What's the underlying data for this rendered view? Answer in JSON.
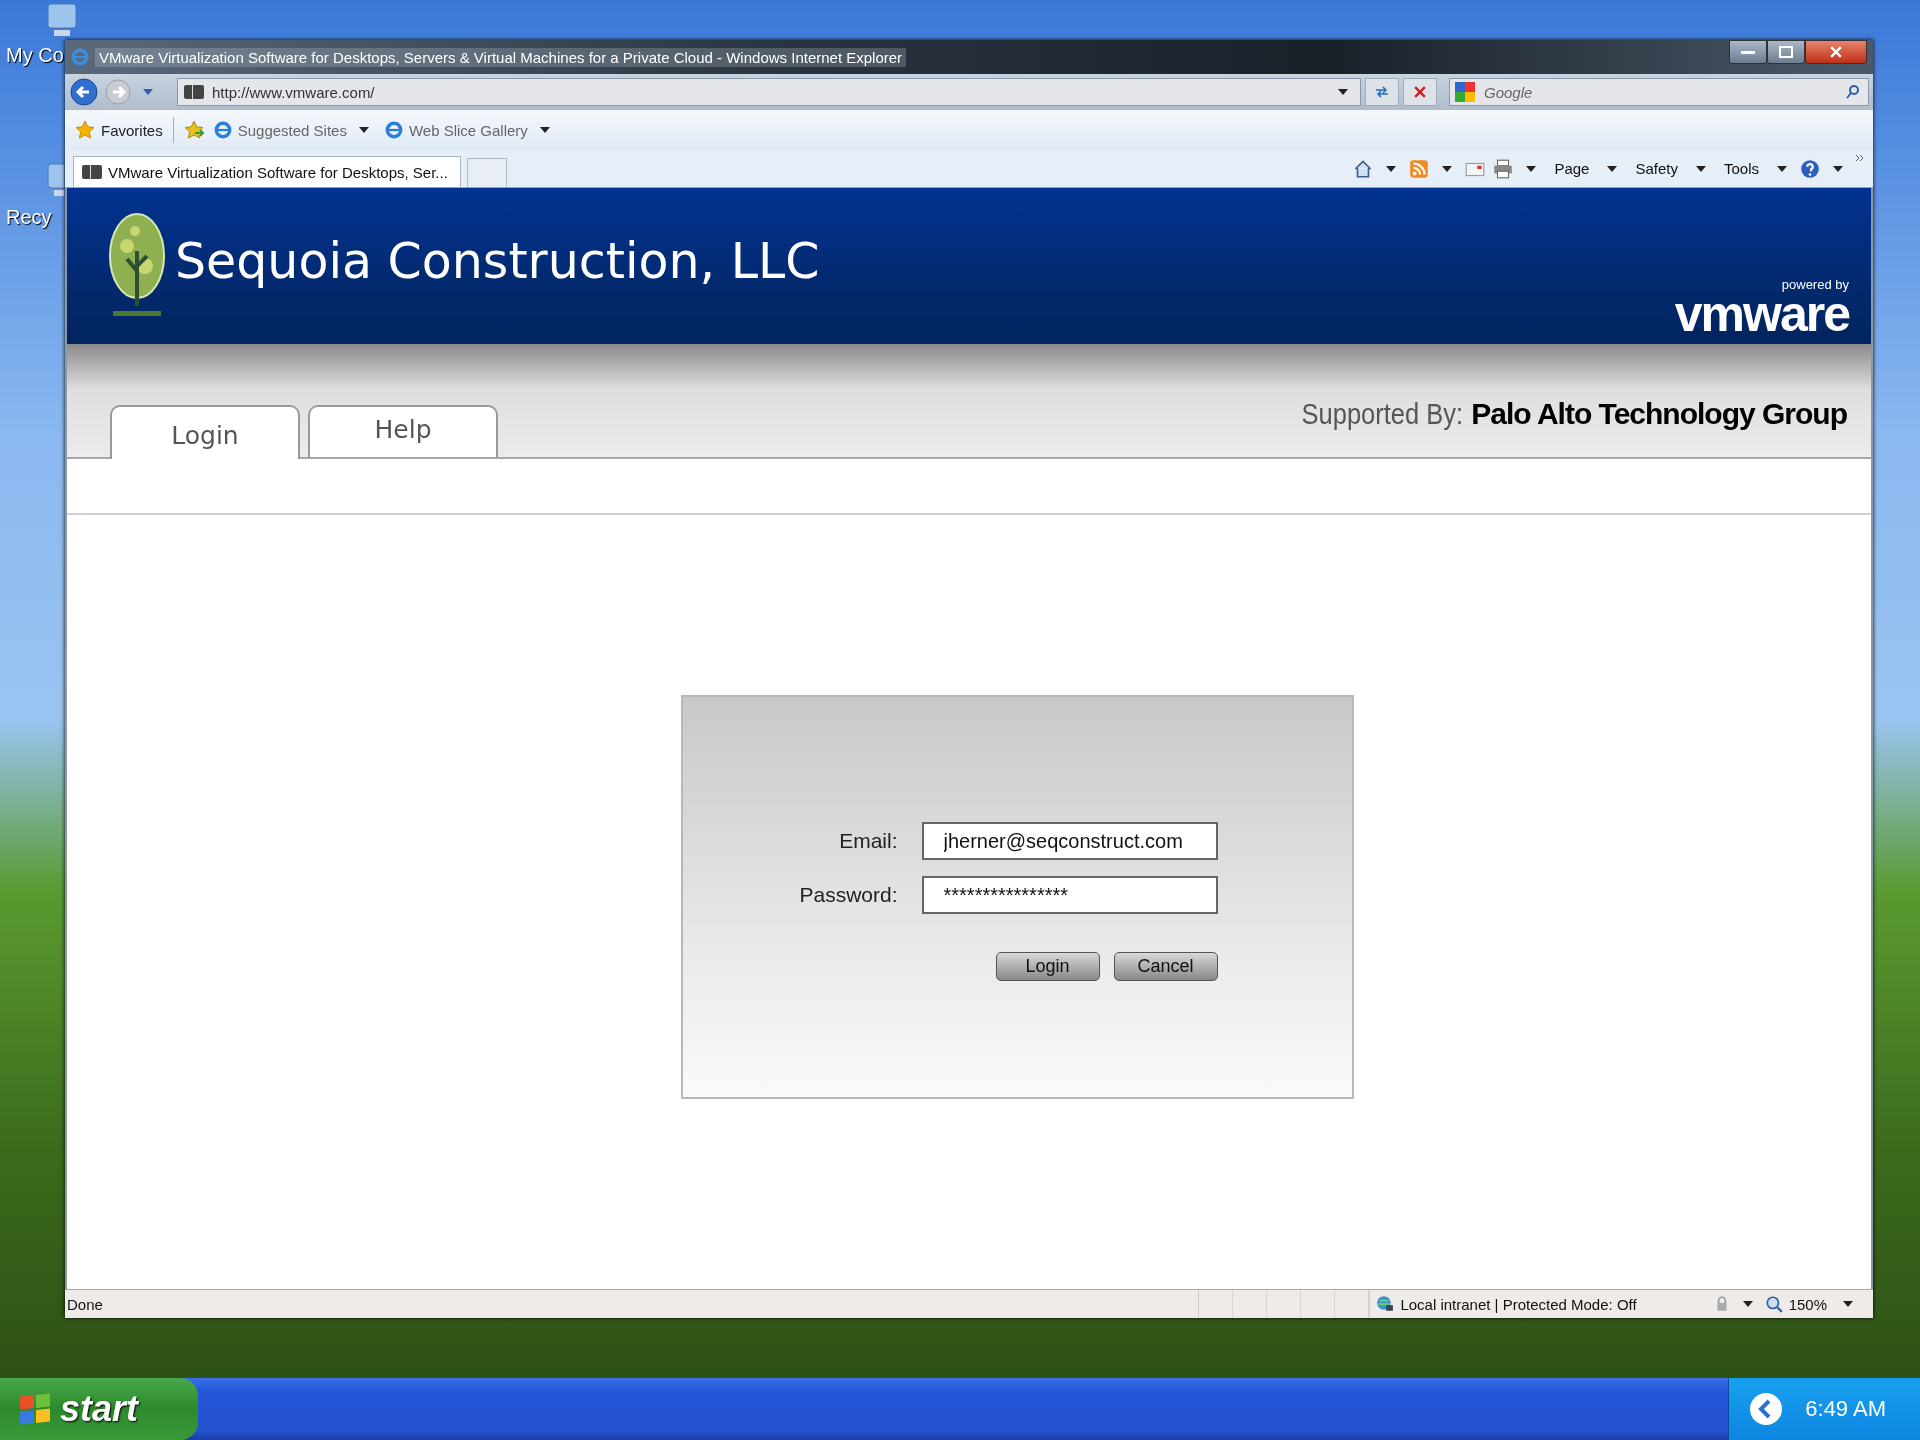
{
  "desktop": {
    "icons": [
      {
        "label": "My Co"
      },
      {
        "label": "Recy"
      }
    ]
  },
  "window": {
    "title": "VMware Virtualization Software for Desktops, Servers & Virtual Machines for a Private Cloud - Windows Internet Explorer"
  },
  "address_bar": {
    "url": "http://www.vmware.com/"
  },
  "search": {
    "placeholder": "Google"
  },
  "favorites_bar": {
    "items": [
      {
        "label": "Favorites"
      },
      {
        "label": "Suggested Sites"
      },
      {
        "label": "Web Slice Gallery"
      }
    ]
  },
  "browser_tabs": [
    {
      "label": "VMware Virtualization Software for Desktops, Ser...",
      "selected": true
    }
  ],
  "command_bar": {
    "menus": [
      "Page",
      "Safety",
      "Tools"
    ]
  },
  "page": {
    "company": "Sequoia Construction, LLC",
    "powered_by": "powered by",
    "brand": "vmware",
    "tabs": [
      {
        "label": "Login",
        "selected": true
      },
      {
        "label": "Help",
        "selected": false
      }
    ],
    "supported_label": "Supported By:",
    "supported_name": "Palo Alto Technology Group",
    "form": {
      "fields": [
        {
          "label": "Email:",
          "value": "jherner@seqconstruct.com"
        },
        {
          "label": "Password:",
          "value": "****************"
        }
      ],
      "buttons": [
        "Login",
        "Cancel"
      ]
    }
  },
  "status_bar": {
    "status": "Done",
    "zone": "Local intranet | Protected Mode: Off",
    "zoom": "150%"
  },
  "taskbar": {
    "start": "start",
    "clock": "6:49 AM"
  }
}
